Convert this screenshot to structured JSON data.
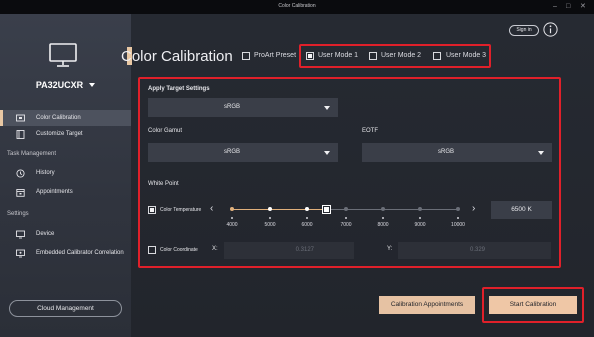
{
  "window": {
    "title": "Color Calibration",
    "minimize_glyph": "–",
    "maximize_glyph": "□",
    "close_glyph": "✕"
  },
  "sidebar": {
    "monitor_icon": "monitor-icon",
    "model_name": "PA32UCXR",
    "items": [
      {
        "label": "Color Calibration",
        "icon": "calibration-icon",
        "active": true
      },
      {
        "label": "Customize Target",
        "icon": "target-icon",
        "active": false
      }
    ],
    "sections": [
      {
        "label": "Task Management",
        "items": [
          {
            "label": "History",
            "icon": "history-icon"
          },
          {
            "label": "Appointments",
            "icon": "calendar-icon"
          }
        ]
      },
      {
        "label": "Settings",
        "items": [
          {
            "label": "Device",
            "icon": "device-icon"
          },
          {
            "label": "Embedded Calibrator Correlation",
            "icon": "correlation-icon"
          }
        ]
      }
    ],
    "cloud_button": "Cloud Management"
  },
  "header": {
    "sign_in": "Sign in",
    "page_title": "Color Calibration",
    "presets": [
      {
        "label": "ProArt Preset",
        "checked": false
      },
      {
        "label": "User Mode 1",
        "checked": true
      },
      {
        "label": "User Mode 2",
        "checked": false
      },
      {
        "label": "User Mode 3",
        "checked": false
      }
    ]
  },
  "target": {
    "section_title": "Apply Target Settings",
    "target_value": "sRGB",
    "gamut_label": "Color Gamut",
    "gamut_value": "sRGB",
    "eotf_label": "EOTF",
    "eotf_value": "sRGB",
    "white_point_label": "White Point",
    "color_temp_label": "Color Temperature",
    "color_temp_checked": true,
    "temp_ticks": [
      "4000",
      "5000",
      "6000",
      "7000",
      "8000",
      "9000",
      "10000"
    ],
    "selected_temp": "6500 K",
    "coord_label": "Color Coordinate",
    "coord_checked": false,
    "x_label": "X:",
    "x_placeholder": "0.3127",
    "y_label": "Y:",
    "y_placeholder": "0.329"
  },
  "footer": {
    "appointments_button": "Calibration Appointments",
    "start_button": "Start Calibration"
  },
  "colors": {
    "accent": "#e9c8a4",
    "highlight_red": "#e0202a",
    "slider_active": "#e0b07c"
  }
}
